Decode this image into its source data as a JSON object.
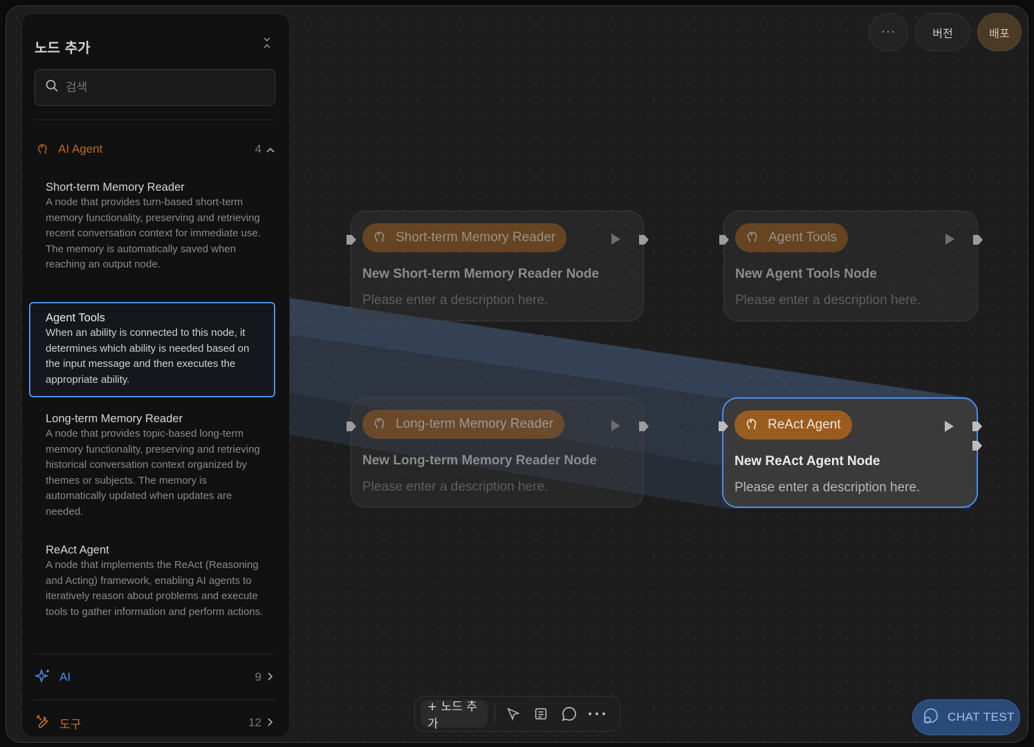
{
  "header": {
    "more_label": "···",
    "version_label": "버전",
    "deploy_label": "배포"
  },
  "panel": {
    "title": "노드 추가",
    "search_placeholder": "검색",
    "categories": [
      {
        "label": "AI Agent",
        "count": "4",
        "icon": "brain-icon",
        "color": "#b86a22",
        "expanded": true
      },
      {
        "label": "AI",
        "count": "9",
        "icon": "sparkles-icon",
        "color": "#4b8ef0",
        "expanded": false
      },
      {
        "label": "도구",
        "count": "12",
        "icon": "tools-icon",
        "color": "#c0722c",
        "expanded": false
      }
    ],
    "items": [
      {
        "title": "Short-term Memory Reader",
        "desc": "A node that provides turn-based short-term memory functionality, preserving and retrieving recent conversation context for immediate use. The memory is automatically saved when reaching an output node."
      },
      {
        "title": "Agent Tools",
        "desc": "When an ability is connected to this node, it determines which ability is needed based on the input message and then executes the appropriate ability.",
        "selected": true
      },
      {
        "title": "Long-term Memory Reader",
        "desc": "A node that provides topic-based long-term memory functionality, preserving and retrieving historical conversation context organized by themes or subjects. The memory is automatically updated when updates are needed."
      },
      {
        "title": "ReAct Agent",
        "desc": "A node that implements the ReAct (Reasoning and Acting) framework, enabling AI agents to iteratively reason about problems and execute tools to gather information and perform actions."
      }
    ]
  },
  "nodes": [
    {
      "chip": "Short-term Memory Reader",
      "title": "New Short-term Memory Reader Node",
      "desc": "Please enter a description here.",
      "state": "dim"
    },
    {
      "chip": "Agent Tools",
      "title": "New Agent Tools Node",
      "desc": "Please enter a description here.",
      "state": "dim"
    },
    {
      "chip": "Long-term Memory Reader",
      "title": "New Long-term Memory Reader Node",
      "desc": "Please enter a description here.",
      "state": "dim"
    },
    {
      "chip": "ReAct Agent",
      "title": "New ReAct Agent Node",
      "desc": "Please enter a description here.",
      "state": "active"
    }
  ],
  "toolbar": {
    "add_node_label": "+ 노드 추가",
    "icons": [
      "cursor-icon",
      "note-icon",
      "comment-icon",
      "more-icon"
    ]
  },
  "chat_test": {
    "label": "CHAT TEST"
  },
  "colors": {
    "accent": "#4b8ef0",
    "node_chip": "#9a5c1e",
    "deploy": "#4a3a26"
  }
}
